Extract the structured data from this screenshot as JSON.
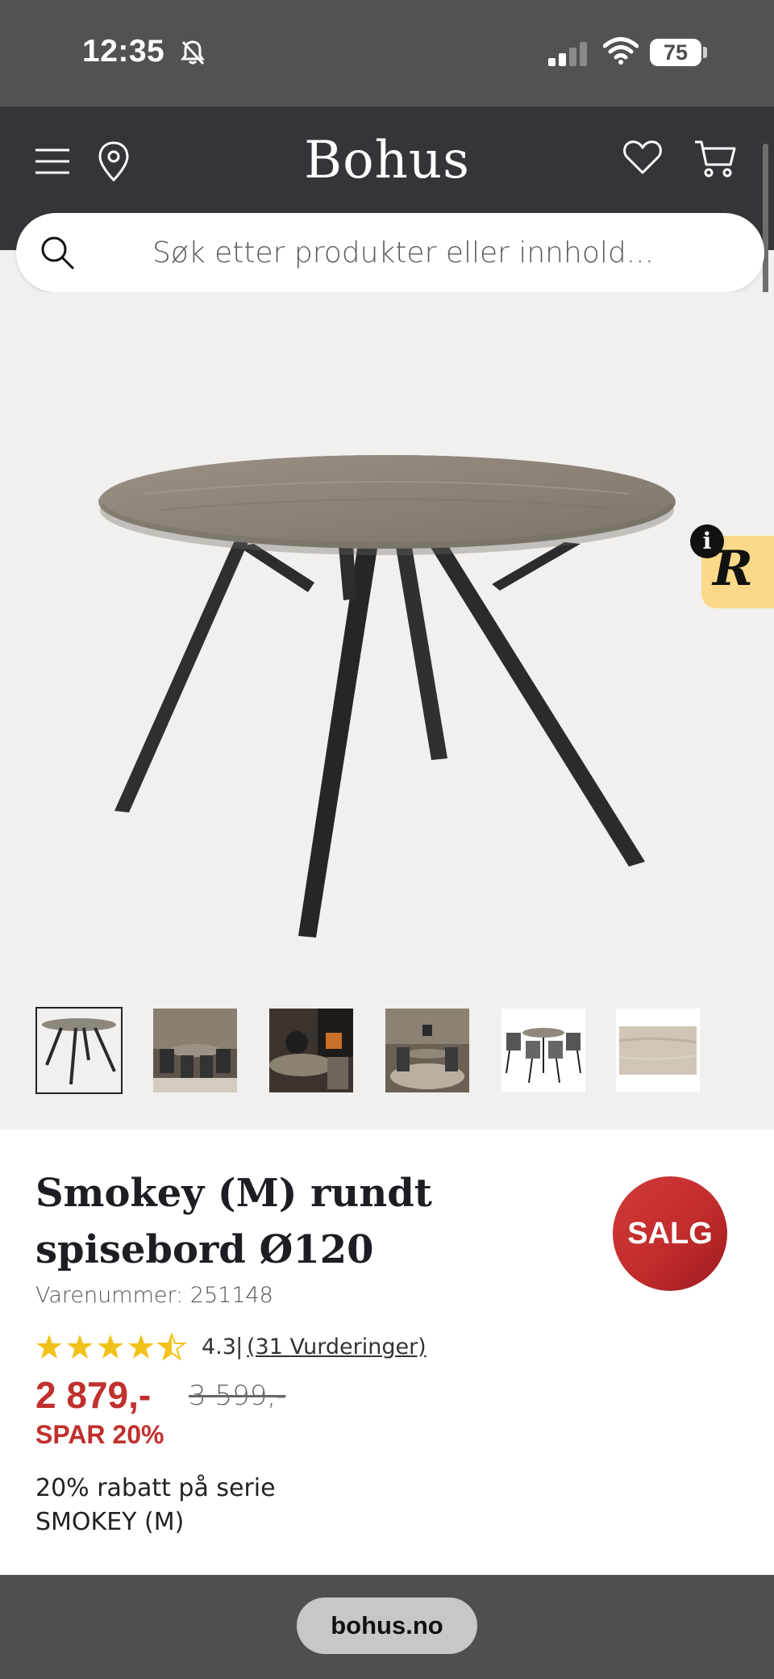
{
  "status_bar": {
    "time": "12:35",
    "battery": "75",
    "icons": [
      "bell-slash-icon",
      "signal-icon",
      "wifi-icon",
      "battery-icon"
    ]
  },
  "header": {
    "brand": "Bohus",
    "icons": [
      "menu-icon",
      "location-pin-icon",
      "heart-icon",
      "cart-icon"
    ],
    "background": "#353539"
  },
  "search": {
    "placeholder": "Søk etter produkter eller innhold..."
  },
  "widget": {
    "letter": "R",
    "info": "i",
    "color": "#fbd98a"
  },
  "gallery": {
    "thumbnail_count": 6,
    "active_index": 0
  },
  "product": {
    "title": "Smokey (M) rundt spisebord Ø120",
    "sku": "Varenummer: 251148",
    "badge": "SALG",
    "rating": 4.3,
    "rating_label": "4.3",
    "rating_separator": "|",
    "reviews": "(31 Vurderinger)",
    "price": "2 879,-",
    "old_price": "3 599,-",
    "savings": "SPAR 20%",
    "promo": "20% rabatt på serie SMOKEY (M)"
  },
  "colors": {
    "price_red": "#c0302d",
    "star_yellow": "#f2c21b"
  },
  "browser": {
    "url": "bohus.no"
  }
}
